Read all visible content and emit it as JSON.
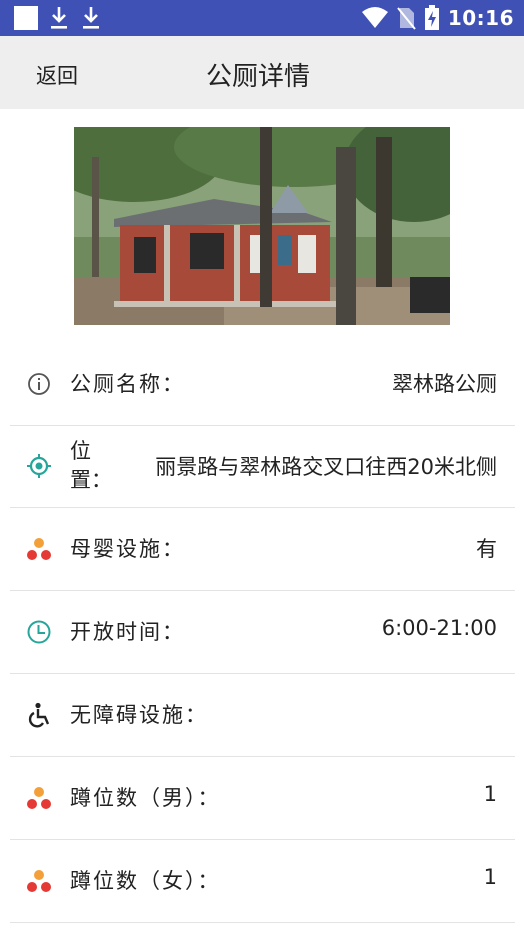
{
  "status_bar": {
    "time": "10:16",
    "icons": [
      "app-square-icon",
      "download-icon",
      "download-icon",
      "wifi-icon",
      "no-sim-icon",
      "battery-charging-icon"
    ]
  },
  "app_bar": {
    "back_label": "返回",
    "title": "公厕详情"
  },
  "photo": {
    "subject": "toilet-building-photo"
  },
  "details": [
    {
      "icon": "info-icon",
      "label": "公厕名称：",
      "value": "翠林路公厕"
    },
    {
      "icon": "location-icon",
      "label": "位置：",
      "value": "丽景路与翠林路交叉口往西20米北侧"
    },
    {
      "icon": "facility-icon",
      "label": "母婴设施：",
      "value": "有"
    },
    {
      "icon": "clock-icon",
      "label": "开放时间：",
      "value": "6:00-21:00"
    },
    {
      "icon": "wheelchair-icon",
      "label": "无障碍设施：",
      "value": ""
    },
    {
      "icon": "facility-icon",
      "label": "蹲位数（男）：",
      "value": "1"
    },
    {
      "icon": "facility-icon",
      "label": "蹲位数（女）：",
      "value": "1"
    }
  ],
  "colors": {
    "status_bar": "#3f51b5",
    "app_bar": "#eeeeee",
    "teal_icon": "#26a69a",
    "red_icon": "#e53935",
    "orange_icon": "#f4a03a"
  }
}
